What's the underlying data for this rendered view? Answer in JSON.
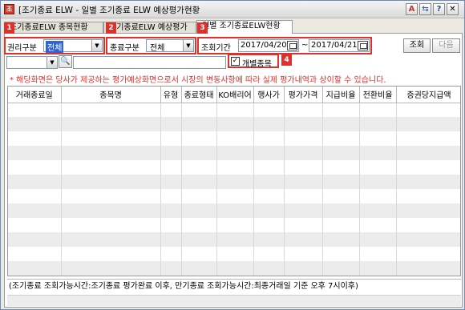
{
  "window": {
    "title": "[조기종료 ELW - 일별 조기종료 ELW 예상평가현황",
    "icon_label": "조",
    "controls": {
      "a_label": "A",
      "b_label": "⇆",
      "help_label": "?",
      "close_label": "✕"
    }
  },
  "tabs": [
    {
      "label": "조기종료ELW 종목현황",
      "active": false
    },
    {
      "label": "조기종료ELW 예상평가",
      "active": false
    },
    {
      "label": "일별 조기종료ELW현황",
      "active": true
    }
  ],
  "filters": {
    "right_type_label": "권리구분",
    "right_type_value": "전체",
    "end_type_label": "종료구분",
    "end_type_value": "전체",
    "period_label": "조회기간",
    "date_from": "2017/04/20",
    "date_sep": "~",
    "date_to": "2017/04/21",
    "individual_label": "개별종목",
    "individual_checked": "✓",
    "search_icon": "magnifier-icon"
  },
  "buttons": {
    "query": "조회",
    "next": "다음"
  },
  "badges": [
    "1",
    "2",
    "3",
    "4"
  ],
  "notice": "* 해당화면은 당사가 제공하는 평가예상화면으로서 시장의 변동사항에 따라 실제 평가내역과 상이할 수 있습니다.",
  "table": {
    "columns": [
      "거래종료일",
      "종목명",
      "유형",
      "종료형태",
      "KO배리어",
      "행사가",
      "평가가격",
      "지급비율",
      "전환비율",
      "증권당지급액"
    ],
    "row_count": 12
  },
  "status": "(조기종료 조회가능시간:조기종료 평가완료 이후, 만기종료 조회가능시간:최종거래일 기준 오후 7시이후)",
  "colors": {
    "highlight": "#e0302a",
    "selection": "#2f64d7"
  }
}
